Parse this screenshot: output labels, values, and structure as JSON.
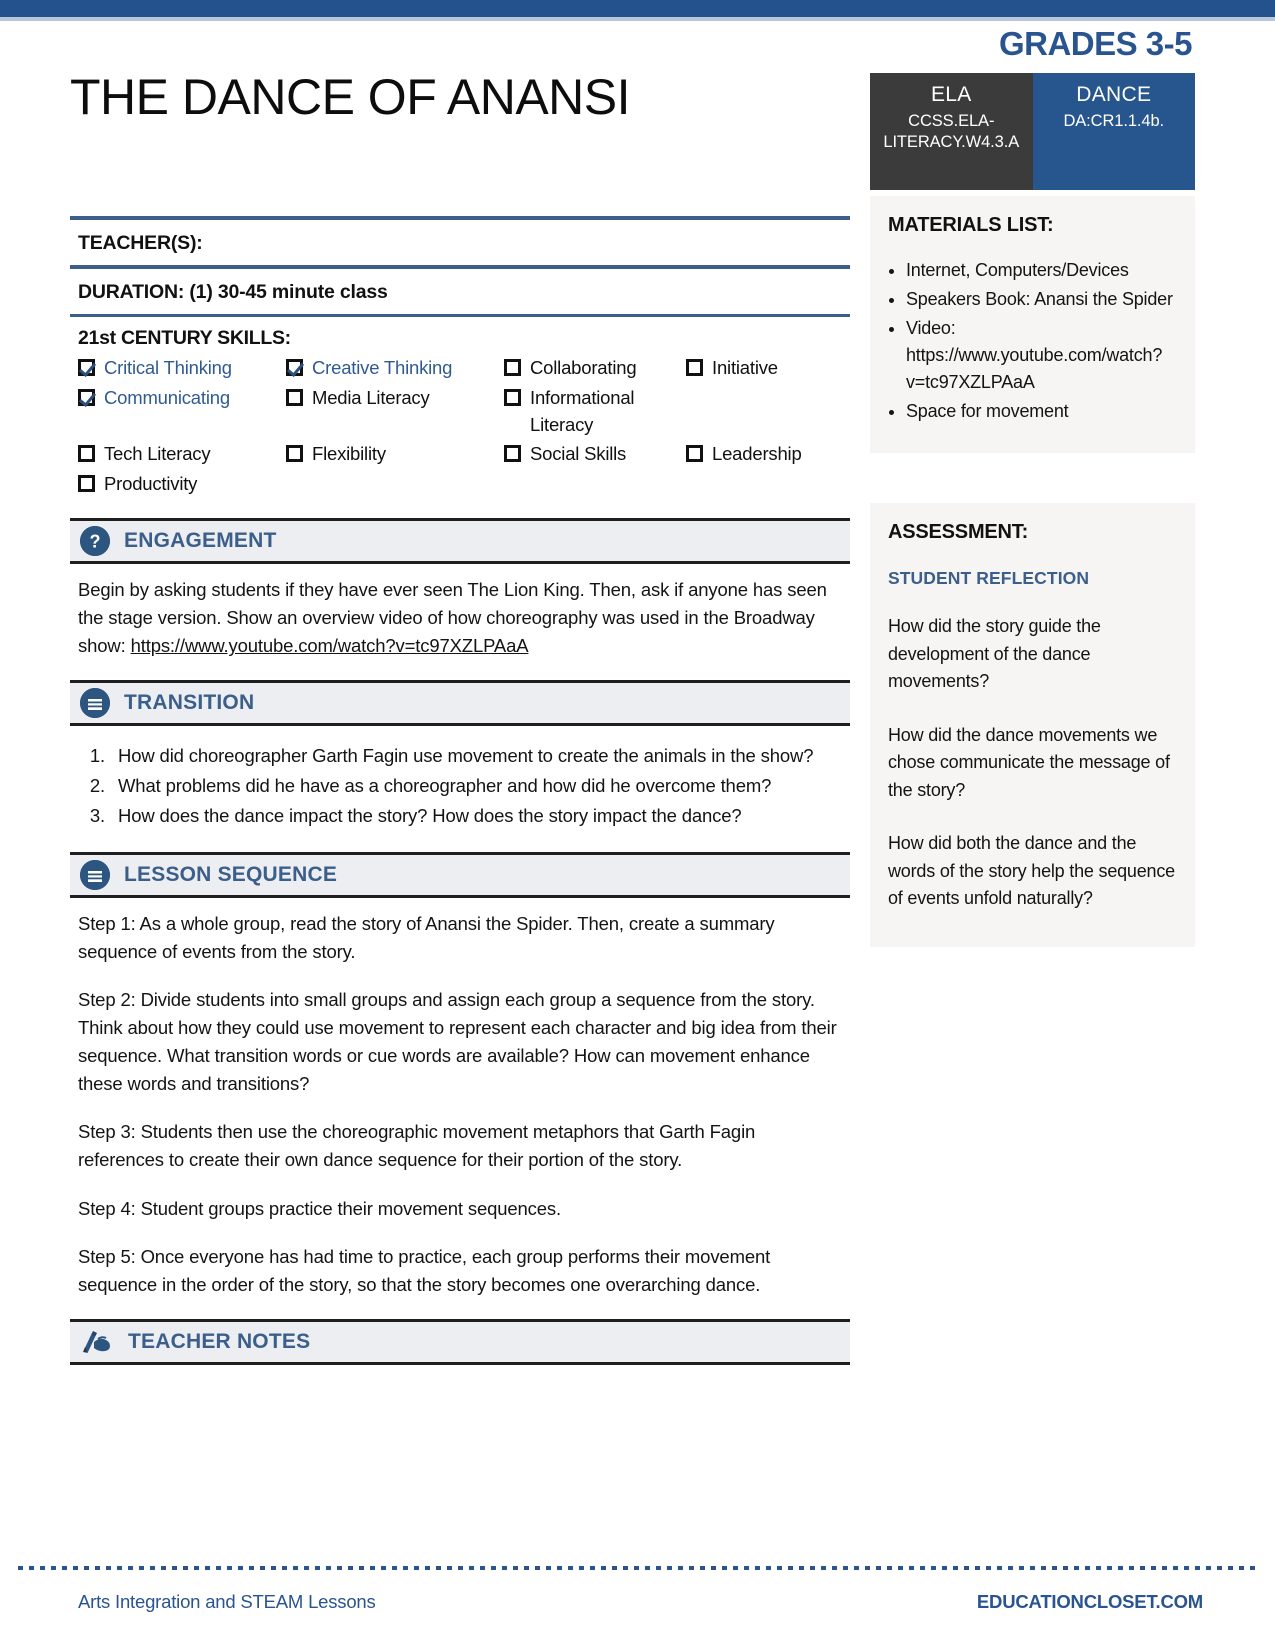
{
  "document": {
    "title": "THE DANCE OF ANANSI",
    "grades": "GRADES 3-5"
  },
  "standards": [
    {
      "subject": "ELA",
      "code": "CCSS.ELA-LITERACY.W4.3.A",
      "color": "#3b3b3b"
    },
    {
      "subject": "DANCE",
      "code": "DA:CR1.1.4b.",
      "color": "#27558e"
    }
  ],
  "fields": {
    "teacher_label": "TEACHER(S):",
    "teacher_value": "",
    "duration_label": "DURATION:",
    "duration_value": " (1) 30-45 minute class"
  },
  "skills": {
    "title": "21st CENTURY SKILLS:",
    "items": [
      {
        "label": "Critical Thinking",
        "checked": true
      },
      {
        "label": "Creative Thinking",
        "checked": true
      },
      {
        "label": "Collaborating",
        "checked": false
      },
      {
        "label": "Initiative",
        "checked": false
      },
      {
        "label": "Communicating",
        "checked": true
      },
      {
        "label": "Media Literacy",
        "checked": false
      },
      {
        "label": "Informational Literacy",
        "checked": false
      },
      {
        "label": "",
        "checked": false
      },
      {
        "label": "Tech Literacy",
        "checked": false
      },
      {
        "label": "Flexibility",
        "checked": false
      },
      {
        "label": "Social Skills",
        "checked": false
      },
      {
        "label": "Leadership",
        "checked": false
      },
      {
        "label": "Productivity",
        "checked": false
      }
    ]
  },
  "sections": {
    "engagement": {
      "title": "ENGAGEMENT",
      "icon": "question-mark-circle-icon",
      "body_before_link": "Begin by asking students if they have ever seen The Lion King. Then, ask if anyone has seen the stage version. Show an overview video of how choreography was used in the Broadway show: ",
      "body_link": "https://www.youtube.com/watch?v=tc97XZLPAaA"
    },
    "transition": {
      "title": "TRANSITION",
      "icon": "list-document-circle-icon",
      "questions": [
        "How did choreographer Garth Fagin use movement to create the animals in the show?",
        "What problems did he have as a choreographer and how did he overcome them?",
        "How does the dance impact the story? How does the story impact the dance?"
      ]
    },
    "lesson_sequence": {
      "title": "LESSON SEQUENCE",
      "icon": "list-document-circle-icon",
      "steps": [
        "Step 1: As a whole group, read the story of Anansi the Spider. Then, create a summary sequence of events from the story.",
        "Step 2: Divide students into small groups and assign each group a sequence from the story. Think about how they could use movement to represent each character and big idea from their sequence. What transition words or cue words are available? How can movement enhance these words and transitions?",
        "Step 3: Students then use the choreographic movement metaphors that Garth Fagin references to create their own dance sequence for their portion of the story.",
        "Step 4: Student groups practice their movement sequences.",
        "Step 5: Once everyone has had time to practice, each group performs their movement sequence in the order of the story, so that the story becomes one overarching dance."
      ]
    },
    "teacher_notes": {
      "title": "TEACHER NOTES",
      "icon": "writing-hand-icon",
      "body": ""
    }
  },
  "materials": {
    "title": "MATERIALS LIST:",
    "items": [
      "Internet, Computers/Devices",
      "Speakers Book: Anansi the Spider",
      "Video: https://www.youtube.com/watch?v=tc97XZLPAaA",
      "Space for movement"
    ]
  },
  "assessment": {
    "title": "ASSESSMENT:",
    "subtitle": "STUDENT REFLECTION",
    "questions": [
      "How did the story guide the development of the dance movements?",
      "How did the dance movements we chose communicate the message of the story?",
      "How did both the dance and the words of the story help the sequence of events unfold naturally?"
    ]
  },
  "footer": {
    "left": "Arts Integration and STEAM Lessons",
    "right": "EDUCATIONCLOSET.COM"
  },
  "colors": {
    "accent_blue": "#2a5490",
    "band_blue": "#23528c",
    "dark_gray": "#3b3b3b",
    "panel_bg": "#f6f5f3",
    "section_band": "#eceef1"
  }
}
